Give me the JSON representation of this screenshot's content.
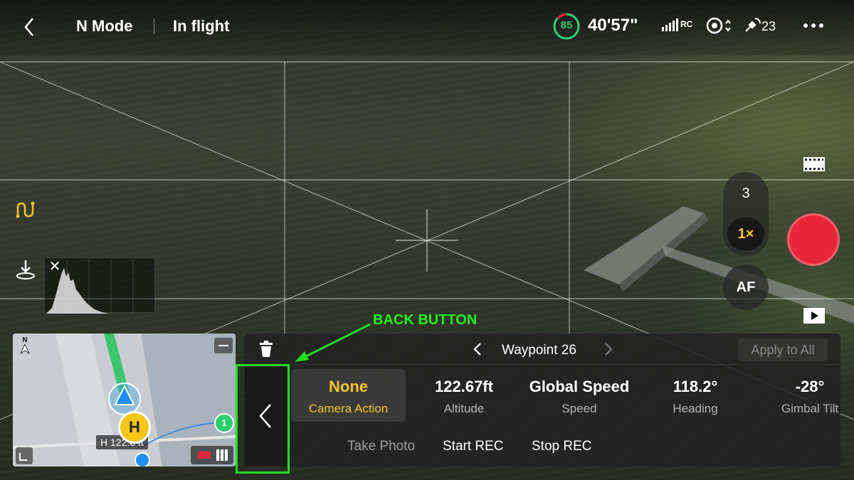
{
  "status_bar": {
    "mode": "N Mode",
    "flight_state": "In flight",
    "battery_percent": 85,
    "battery_percent_text": "85",
    "flight_time": "40'57\"",
    "rc_label": "RC",
    "gps_satellites": "23",
    "battery_color": "#2fcf7a"
  },
  "camera_controls": {
    "zoom_option": "3",
    "zoom_active": "1×",
    "af_label": "AF",
    "record_color": "#e8283a",
    "accent_color": "#f6c42f"
  },
  "histogram": {
    "close_label": "✕"
  },
  "minimap": {
    "north_label": "N",
    "home_label": "H",
    "height_label": "H 122.6 ft",
    "waypoint_label": "1"
  },
  "waypoint_panel": {
    "title": "Waypoint 26",
    "apply_all_label": "Apply to All",
    "params": [
      {
        "value": "None",
        "label": "Camera Action"
      },
      {
        "value": "122.67ft",
        "label": "Altitude"
      },
      {
        "value": "Global Speed",
        "label": "Speed"
      },
      {
        "value": "118.2°",
        "label": "Heading"
      },
      {
        "value": "-28°",
        "label": "Gimbal Tilt"
      }
    ],
    "actions": [
      "Take Photo",
      "Start REC",
      "Stop REC"
    ]
  },
  "annotation": {
    "label": "BACK BUTTON",
    "color": "#22dd22"
  },
  "icons": [
    "back-chevron-icon",
    "signal-strength-icon",
    "vision-sensor-icon",
    "gps-icon",
    "more-icon",
    "waypoint-route-icon",
    "landing-icon",
    "film-strip-icon",
    "playback-icon",
    "delete-icon",
    "chevron-left-icon",
    "chevron-right-icon"
  ]
}
